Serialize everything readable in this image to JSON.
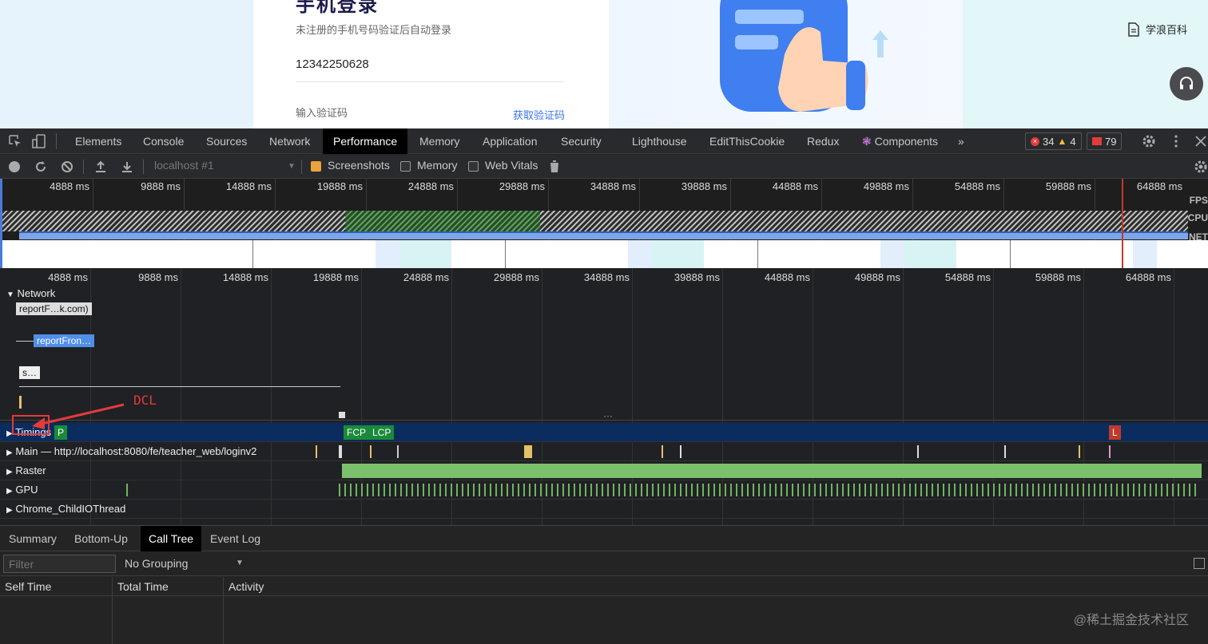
{
  "webpage": {
    "login_title": "手机登录",
    "login_subtitle": "未注册的手机号码验证后自动登录",
    "phone_value": "12342250628",
    "code_placeholder": "输入验证码",
    "get_code_label": "获取验证码",
    "wiki_label": "学浪百科",
    "support_icon": "headset-icon"
  },
  "devtools": {
    "tabs": [
      "Elements",
      "Console",
      "Sources",
      "Network",
      "Performance",
      "Memory",
      "Application",
      "Security",
      "Lighthouse",
      "EditThisCookie",
      "Redux",
      "Components"
    ],
    "active_tab": "Performance",
    "more_tabs": "»",
    "errors": "34",
    "warnings": "4",
    "issues": "79"
  },
  "perf_toolbar": {
    "target": "localhost #1",
    "screenshots_label": "Screenshots",
    "memory_label": "Memory",
    "webvitals_label": "Web Vitals"
  },
  "overview": {
    "ticks": [
      "4888 ms",
      "9888 ms",
      "14888 ms",
      "19888 ms",
      "24888 ms",
      "29888 ms",
      "34888 ms",
      "39888 ms",
      "44888 ms",
      "49888 ms",
      "54888 ms",
      "59888 ms",
      "64888 ms"
    ],
    "fps_label": "FPS",
    "cpu_label": "CPU",
    "net_label": "NET"
  },
  "timeline": {
    "ticks": [
      "4888 ms",
      "9888 ms",
      "14888 ms",
      "19888 ms",
      "24888 ms",
      "29888 ms",
      "34888 ms",
      "39888 ms",
      "44888 ms",
      "49888 ms",
      "54888 ms",
      "59888 ms",
      "64888 ms"
    ],
    "network_header": "Network",
    "requests": [
      "reportF…k.com)",
      "reportFron…",
      "s…"
    ],
    "annotation": "DCL",
    "tracks": {
      "timings": "Timings",
      "main": "Main — http://localhost:8080/fe/teacher_web/loginv2",
      "raster": "Raster",
      "gpu": "GPU",
      "io": "Chrome_ChildIOThread"
    },
    "markers": {
      "fcp": "FCP",
      "lcp": "LCP",
      "l": "L",
      "p": "P"
    }
  },
  "bottom": {
    "tabs": [
      "Summary",
      "Bottom-Up",
      "Call Tree",
      "Event Log"
    ],
    "active_tab": "Call Tree",
    "filter_placeholder": "Filter",
    "grouping": "No Grouping",
    "columns": [
      "Self Time",
      "Total Time",
      "Activity"
    ]
  },
  "watermark": "@稀土掘金技术社区"
}
